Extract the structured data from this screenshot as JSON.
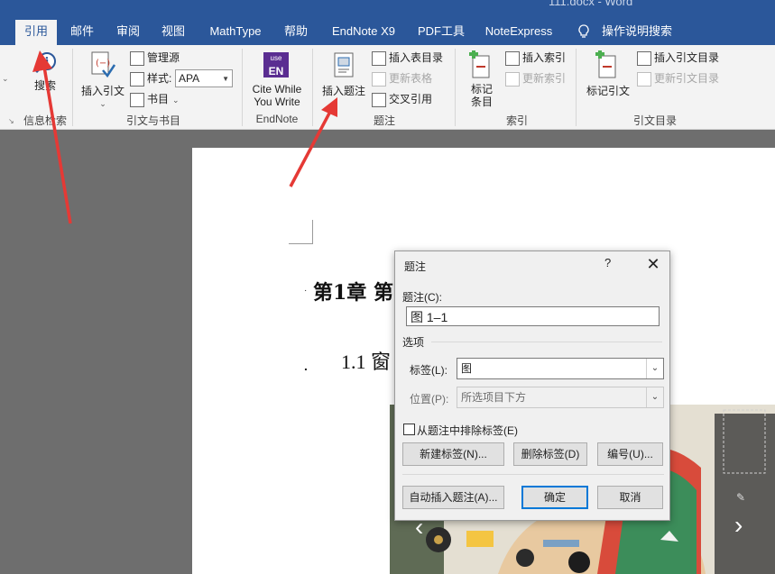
{
  "window": {
    "title": "111.docx  -  Word"
  },
  "tabs": [
    {
      "label": "引用"
    },
    {
      "label": "邮件"
    },
    {
      "label": "审阅"
    },
    {
      "label": "视图"
    },
    {
      "label": "MathType"
    },
    {
      "label": "帮助"
    },
    {
      "label": "EndNote X9"
    },
    {
      "label": "PDF工具"
    },
    {
      "label": "NoteExpress"
    }
  ],
  "tell_me": "操作说明搜索",
  "ribbon": {
    "info_search": {
      "button": "搜索",
      "group": "信息检索"
    },
    "citations": {
      "insert_citation": "插入引文",
      "manage_sources": "管理源",
      "style_label": "样式:",
      "style_value": "APA",
      "bibliography": "书目",
      "group": "引文与书目"
    },
    "endnote": {
      "logo_text": "EN",
      "logo_top": "use",
      "button_line1": "Cite While",
      "button_line2": "You Write",
      "group": "EndNote"
    },
    "captions": {
      "insert_caption": "插入题注",
      "insert_table_of_figures": "插入表目录",
      "update_table": "更新表格",
      "cross_reference": "交叉引用",
      "group": "题注"
    },
    "index": {
      "mark_entry_line1": "标记",
      "mark_entry_line2": "条目",
      "insert_index": "插入索引",
      "update_index": "更新索引",
      "group": "索引"
    },
    "toa": {
      "mark_citation": "标记引文",
      "insert_toa": "插入引文目录",
      "update_toa": "更新引文目录",
      "group": "引文目录"
    }
  },
  "document": {
    "heading": "第1章 第",
    "subheading": "1.1 窗"
  },
  "dialog": {
    "title": "题注",
    "help": "?",
    "caption_label": "题注(C):",
    "caption_value": "图  1–1",
    "options_label": "选项",
    "label_label": "标签(L):",
    "label_value": "图",
    "position_label": "位置(P):",
    "position_value": "所选项目下方",
    "exclude_label": "从题注中排除标签(E)",
    "exclude_checked": false,
    "new_label_btn": "新建标签(N)...",
    "delete_label_btn": "删除标签(D)",
    "numbering_btn": "编号(U)...",
    "autocaption_btn": "自动插入题注(A)...",
    "ok_btn": "确定",
    "cancel_btn": "取消"
  },
  "colors": {
    "accent": "#2b579a",
    "arrow": "#e53935",
    "dialog_default": "#0078d7"
  },
  "icons": [
    "info-icon",
    "insert-citation-icon",
    "manage-sources-icon",
    "style-icon",
    "bibliography-icon",
    "endnote-icon",
    "insert-caption-icon",
    "table-of-figures-icon",
    "update-table-icon",
    "cross-reference-icon",
    "mark-entry-icon",
    "insert-index-icon",
    "update-index-icon",
    "mark-citation-icon",
    "insert-toa-icon",
    "update-toa-icon",
    "lightbulb-icon",
    "close-icon",
    "chevron-down-icon",
    "chevron-left-icon",
    "chevron-right-icon",
    "pencil-icon"
  ]
}
